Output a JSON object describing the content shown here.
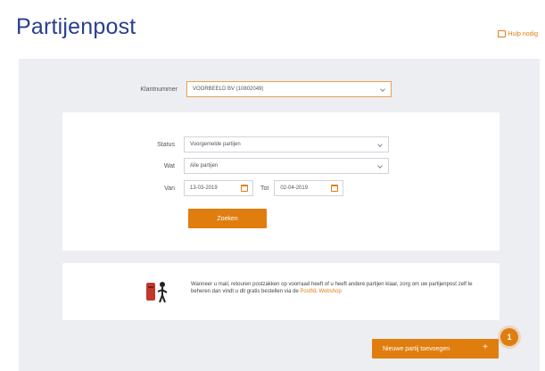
{
  "header": {
    "title": "Partijenpost",
    "help_label": "Hulp nodig"
  },
  "filters": {
    "klantnummer_label": "Klantnummer",
    "klantnummer_value": "VOORBEELD BV (10802049)"
  },
  "search": {
    "status_label": "Status",
    "status_value": "Voorgemelde partijen",
    "wat_label": "Wat",
    "wat_value": "Alle partijen",
    "van_label": "Van",
    "van_value": "13-03-2019",
    "tot_label": "Tot",
    "tot_value": "02-04-2019",
    "search_button": "Zoeken"
  },
  "info": {
    "text": "Wanneer u mail, retouren postzakken op voorraad heeft of u heeft andere partijen klaar, zorg om uw partijenpost zelf te beheren dan vindt u dit gratis bestellen via de",
    "link": "PostNL Webshop"
  },
  "actions": {
    "new_batch_button": "Nieuwe partij toevoegen",
    "step_badge": "1"
  },
  "colors": {
    "accent": "#e07d0f",
    "title": "#2a3f8f",
    "background": "#eceef2"
  }
}
